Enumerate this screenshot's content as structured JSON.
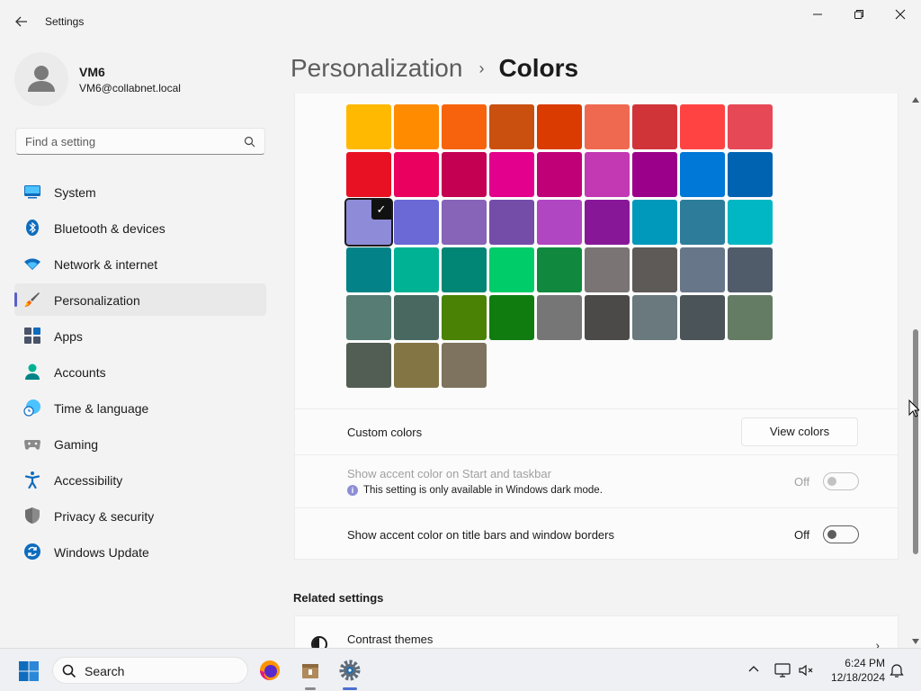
{
  "window": {
    "app_title": "Settings"
  },
  "profile": {
    "name": "VM6",
    "email": "VM6@collabnet.local"
  },
  "search": {
    "placeholder": "Find a setting"
  },
  "nav": {
    "items": [
      {
        "label": "System",
        "icon": "system-icon"
      },
      {
        "label": "Bluetooth & devices",
        "icon": "bluetooth-icon"
      },
      {
        "label": "Network & internet",
        "icon": "wifi-icon"
      },
      {
        "label": "Personalization",
        "icon": "brush-icon",
        "active": true
      },
      {
        "label": "Apps",
        "icon": "apps-icon"
      },
      {
        "label": "Accounts",
        "icon": "accounts-icon"
      },
      {
        "label": "Time & language",
        "icon": "clock-globe-icon"
      },
      {
        "label": "Gaming",
        "icon": "gamepad-icon"
      },
      {
        "label": "Accessibility",
        "icon": "accessibility-icon"
      },
      {
        "label": "Privacy & security",
        "icon": "shield-icon"
      },
      {
        "label": "Windows Update",
        "icon": "update-icon"
      }
    ]
  },
  "header": {
    "parent": "Personalization",
    "separator": "›",
    "current": "Colors"
  },
  "accent_colors": {
    "selected_index": 18,
    "swatches": [
      "#ffb900",
      "#ff8c00",
      "#f7630c",
      "#ca5010",
      "#da3b01",
      "#ef6950",
      "#d13438",
      "#ff4343",
      "#e74856",
      "#e81123",
      "#ea005e",
      "#c30052",
      "#e3008c",
      "#bf0077",
      "#c239b3",
      "#9a0089",
      "#0078d7",
      "#0063b1",
      "#8e8cd8",
      "#6b69d6",
      "#8764b8",
      "#744da9",
      "#b146c2",
      "#881798",
      "#0099bc",
      "#2d7d9a",
      "#00b7c3",
      "#038387",
      "#00b294",
      "#018574",
      "#00cc6a",
      "#10893e",
      "#7a7574",
      "#5d5a58",
      "#68768a",
      "#515c6b",
      "#567c73",
      "#486860",
      "#498205",
      "#107c10",
      "#767676",
      "#4c4a48",
      "#69797e",
      "#4a5459",
      "#647c64",
      "#525e54",
      "#847545",
      "#7e735f"
    ]
  },
  "custom_colors": {
    "label": "Custom colors",
    "button": "View colors"
  },
  "start_taskbar_setting": {
    "label": "Show accent color on Start and taskbar",
    "note": "This setting is only available in Windows dark mode.",
    "state": "Off",
    "enabled": false
  },
  "title_bars_setting": {
    "label": "Show accent color on title bars and window borders",
    "state": "Off"
  },
  "related": {
    "heading": "Related settings",
    "contrast_themes": "Contrast themes"
  },
  "taskbar": {
    "search_text": "Search",
    "time": "6:24 PM",
    "date": "12/18/2024"
  }
}
